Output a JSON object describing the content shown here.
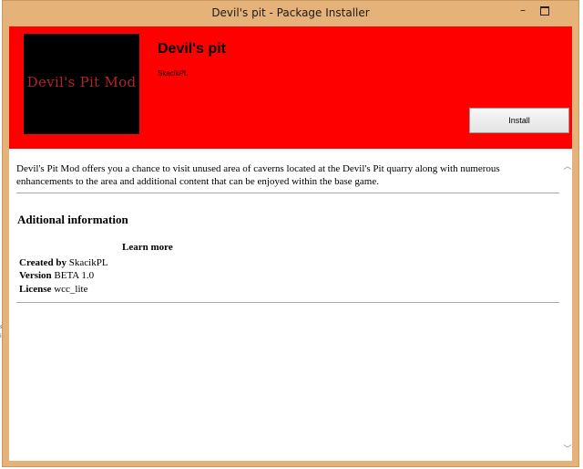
{
  "window": {
    "title": "Devil's pit - Package Installer",
    "minimize_glyph": "–",
    "close_glyph": "✕",
    "accent_color": "#e5b37a"
  },
  "banner": {
    "background_color": "#ff0000",
    "thumbnail_text": "Devil's Pit Mod",
    "package_title": "Devil's pit",
    "author": "SkacikPL",
    "install_label": "Install"
  },
  "content": {
    "description": "Devil's Pit Mod offers you a chance to visit unused area of caverns located at the Devil's Pit quarry along with numerous enhancements to the area and additional content that can be enjoyed within the base game.",
    "section_title": "Aditional information",
    "learn_more": "Learn more",
    "created_by_label": "Created by",
    "created_by_value": "SkacikPL",
    "version_label": "Version",
    "version_value": "BETA 1.0",
    "license_label": "License",
    "license_value": "wcc_lite"
  },
  "scrollbar": {
    "up_glyph": "︿",
    "down_glyph": "﹀"
  },
  "background_peek": {
    "glyph_1": "s",
    "glyph_2": "i"
  }
}
